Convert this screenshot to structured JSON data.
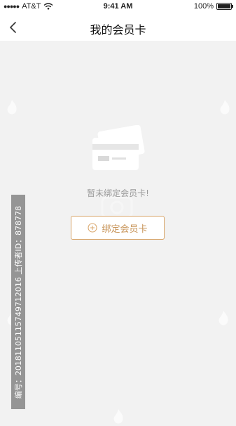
{
  "status_bar": {
    "carrier": "AT&T",
    "time": "9:41 AM",
    "battery": "100%",
    "battery_level": 1.0
  },
  "nav": {
    "title": "我的会员卡",
    "back_icon": "chevron-left-icon"
  },
  "empty_state": {
    "illustration_icon": "cards-icon",
    "message": "暂未绑定会员卡!",
    "action_label": "绑定会员卡",
    "action_icon": "plus-circle-icon"
  },
  "watermark": {
    "text": "编号：20181105115749712016 上传者ID：878778"
  },
  "colors": {
    "background": "#f2f2f2",
    "accent": "#d8a56a",
    "muted_text": "#9a9a9a"
  }
}
